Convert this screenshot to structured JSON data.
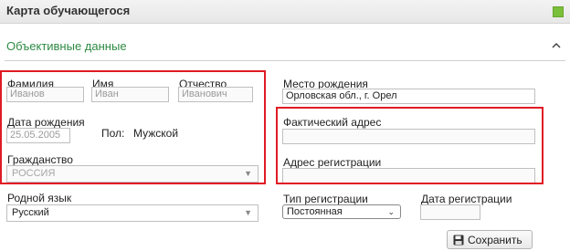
{
  "window": {
    "title": "Карта обучающегося"
  },
  "section": {
    "title": "Объективные данные",
    "toggle_icon": "chevron-up-icon"
  },
  "fields": {
    "last_name": {
      "label": "Фамилия",
      "value": "Иванов"
    },
    "first_name": {
      "label": "Имя",
      "value": "Иван"
    },
    "patronymic": {
      "label": "Отчество",
      "value": "Иванович"
    },
    "birth_date": {
      "label": "Дата рождения",
      "value": "25.05.2005"
    },
    "gender": {
      "label": "Пол:",
      "value": "Мужской"
    },
    "citizenship": {
      "label": "Гражданство",
      "value": "РОССИЯ"
    },
    "native_language": {
      "label": "Родной язык",
      "value": "Русский"
    },
    "birth_place": {
      "label": "Место рождения",
      "value": "Орловская обл., г. Орел"
    },
    "actual_address": {
      "label": "Фактический адрес",
      "value": ""
    },
    "registration_address": {
      "label": "Адрес регистрации",
      "value": ""
    },
    "registration_type": {
      "label": "Тип регистрации",
      "value": "Постоянная"
    },
    "registration_date": {
      "label": "Дата регистрации",
      "value": ""
    }
  },
  "actions": {
    "save_label": "Сохранить",
    "save_icon": "floppy-disk-icon"
  },
  "colors": {
    "section_title": "#2e8b43",
    "highlight": "#e01b24",
    "status_square": "#7bbf3a"
  }
}
